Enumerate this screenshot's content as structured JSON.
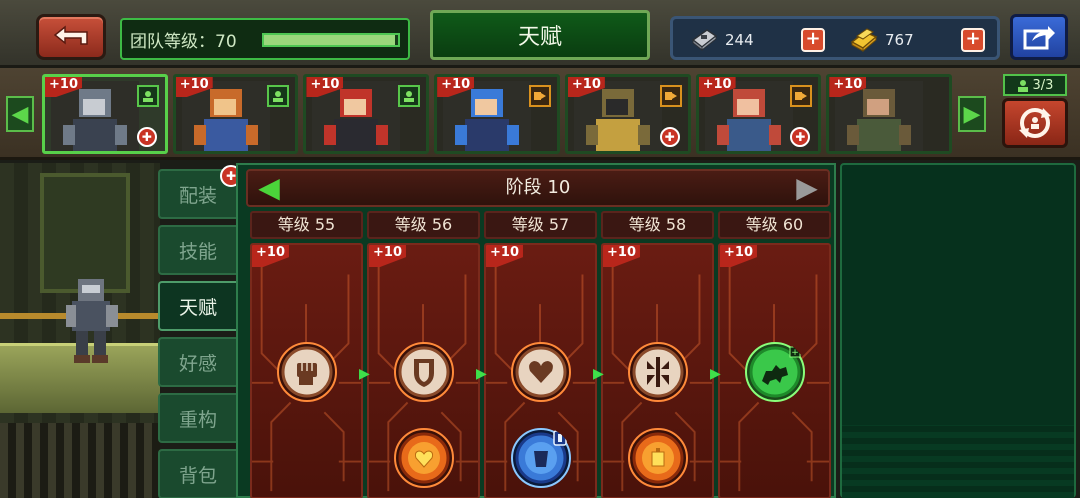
{
  "header": {
    "back_icon": "back-arrow-icon",
    "team_level_label": "团队等级：70",
    "team_level_progress": 0.98,
    "page_title": "天赋",
    "currencies": [
      {
        "icon": "chip-icon",
        "value": "244"
      },
      {
        "icon": "gold-bar-icon",
        "value": "767"
      }
    ],
    "share_icon": "share-icon"
  },
  "heroes": {
    "team_count": "3/3",
    "cards": [
      {
        "plus": "+10",
        "role": "green",
        "alert": true,
        "selected": true
      },
      {
        "plus": "+10",
        "role": "green",
        "alert": false,
        "selected": false
      },
      {
        "plus": "+10",
        "role": "green",
        "alert": false,
        "selected": false
      },
      {
        "plus": "+10",
        "role": "orange",
        "alert": false,
        "selected": false
      },
      {
        "plus": "+10",
        "role": "orange",
        "alert": true,
        "selected": false
      },
      {
        "plus": "+10",
        "role": "orange",
        "alert": true,
        "selected": false
      },
      {
        "plus": "+10",
        "role": "none",
        "alert": false,
        "selected": false
      }
    ]
  },
  "side_tabs": [
    {
      "label": "配装",
      "badge": true,
      "active": false
    },
    {
      "label": "技能",
      "badge": false,
      "active": false
    },
    {
      "label": "天赋",
      "badge": false,
      "active": true
    },
    {
      "label": "好感",
      "badge": false,
      "active": false
    },
    {
      "label": "重构",
      "badge": false,
      "active": false
    },
    {
      "label": "背包",
      "badge": false,
      "active": false
    }
  ],
  "talents": {
    "stage_label": "阶段 10",
    "columns": [
      {
        "level": "等级 55",
        "plus": "+10",
        "top_icon": "fist-icon",
        "bottom_icon": null
      },
      {
        "level": "等级 56",
        "plus": "+10",
        "top_icon": "shield-icon",
        "bottom_icon": "heart-burst-icon"
      },
      {
        "level": "等级 57",
        "plus": "+10",
        "top_icon": "heart-icon",
        "bottom_icon": "armor-blue-icon"
      },
      {
        "level": "等级 58",
        "plus": "+10",
        "top_icon": "spikes-icon",
        "bottom_icon": "bomb-burst-icon"
      },
      {
        "level": "等级 60",
        "plus": "+10",
        "top_icon": "wolf-green-icon",
        "bottom_icon": null
      }
    ]
  }
}
